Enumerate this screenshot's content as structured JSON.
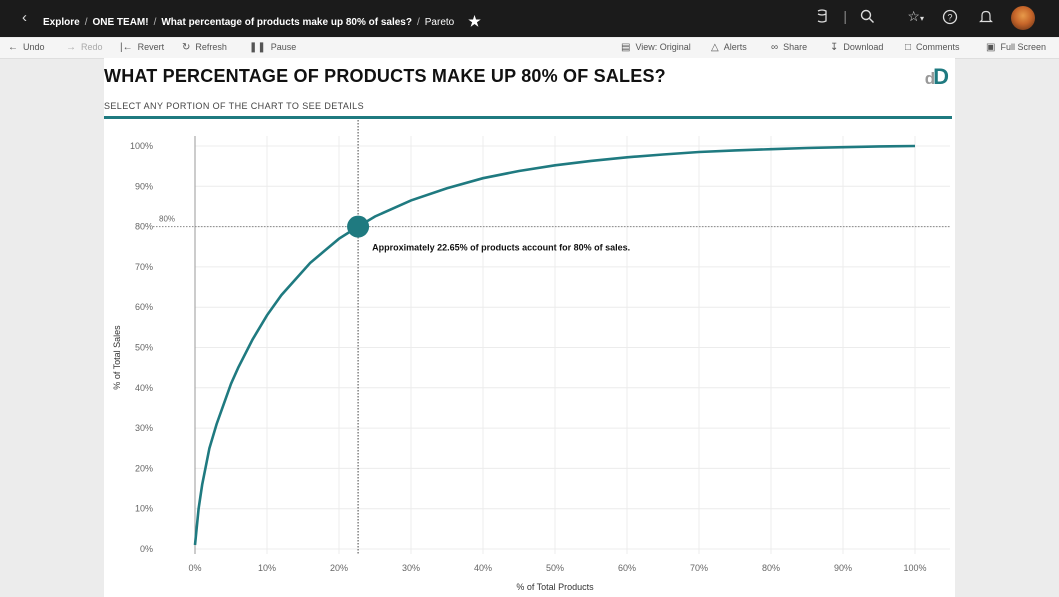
{
  "header": {
    "back_icon": "chevron-left-icon",
    "breadcrumbs": [
      "Explore",
      "ONE TEAM!",
      "What percentage of products make up 80% of sales?"
    ],
    "current": "Pareto",
    "favorite_icon": "star-icon"
  },
  "top_icons": [
    "data-icon",
    "search-icon",
    "star-outline-icon",
    "help-icon",
    "bell-icon",
    "avatar"
  ],
  "toolbar": {
    "undo": "Undo",
    "redo": "Redo",
    "revert": "Revert",
    "refresh": "Refresh",
    "pause": "Pause",
    "view": "View: Original",
    "alerts": "Alerts",
    "share": "Share",
    "download": "Download",
    "comments": "Comments",
    "fullscreen": "Full Screen"
  },
  "dashboard": {
    "title": "WHAT PERCENTAGE OF PRODUCTS MAKE UP 80% OF SALES?",
    "subtitle": "SELECT ANY PORTION OF THE CHART TO SEE DETAILS",
    "logo_small": "d",
    "logo_big": "D",
    "accent_color": "#1f7a80"
  },
  "chart_data": {
    "type": "line",
    "xlabel": "% of Total Products",
    "ylabel": "% of Total Sales",
    "xlim": [
      0,
      100
    ],
    "ylim": [
      0,
      100
    ],
    "x_ticks": [
      "0%",
      "10%",
      "20%",
      "30%",
      "40%",
      "50%",
      "60%",
      "70%",
      "80%",
      "90%",
      "100%"
    ],
    "y_ticks": [
      "0%",
      "10%",
      "20%",
      "30%",
      "40%",
      "50%",
      "60%",
      "70%",
      "80%",
      "90%",
      "100%"
    ],
    "series": [
      {
        "x": [
          0,
          0.5,
          1,
          2,
          3,
          4,
          5,
          6,
          8,
          10,
          12,
          14,
          16,
          18,
          20,
          22.65,
          25,
          30,
          35,
          40,
          45,
          50,
          55,
          60,
          65,
          70,
          75,
          80,
          85,
          90,
          95,
          100
        ],
        "y": [
          1,
          10,
          16,
          25,
          31,
          36,
          41,
          45,
          52,
          58,
          63,
          67,
          71,
          74,
          77,
          80,
          82.5,
          86.5,
          89.5,
          92,
          93.8,
          95.2,
          96.3,
          97.2,
          97.9,
          98.5,
          98.9,
          99.2,
          99.5,
          99.7,
          99.9,
          100
        ]
      }
    ],
    "reference_lines": {
      "x": 22.65,
      "y": 80,
      "y_label": "80%"
    },
    "highlight_point": {
      "x": 22.65,
      "y": 80
    },
    "annotation": "Approximately 22.65% of products account for 80% of sales.",
    "line_color": "#1f7a80",
    "grid": true
  }
}
